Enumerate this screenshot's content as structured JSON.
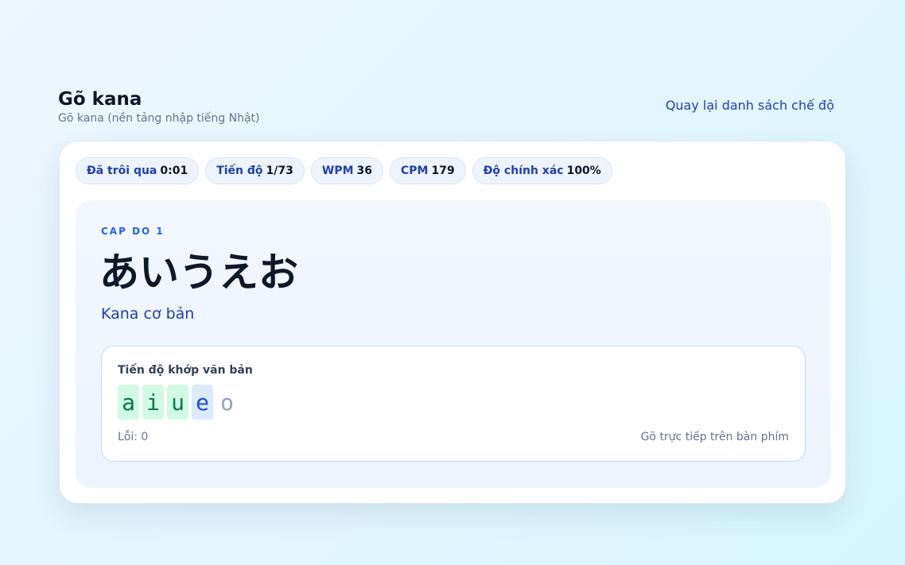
{
  "header": {
    "title": "Gõ kana",
    "subtitle": "Gõ kana (nền tảng nhập tiếng Nhật)",
    "back_link": "Quay lại danh sách chế độ"
  },
  "stats": [
    {
      "label": "Đã trôi qua",
      "value": "0:01"
    },
    {
      "label": "Tiến độ",
      "value": "1/73"
    },
    {
      "label": "WPM",
      "value": "36"
    },
    {
      "label": "CPM",
      "value": "179"
    },
    {
      "label": "Độ chính xác",
      "value": "100%"
    }
  ],
  "lesson": {
    "level_label": "CAP DO 1",
    "kana": "あいうえお",
    "description": "Kana cơ bản"
  },
  "match": {
    "title": "Tiến độ khớp văn bản",
    "chars": [
      {
        "char": "a",
        "state": "done"
      },
      {
        "char": "i",
        "state": "done"
      },
      {
        "char": "u",
        "state": "done"
      },
      {
        "char": "e",
        "state": "current"
      },
      {
        "char": "o",
        "state": "pending"
      }
    ],
    "errors": "Lỗi: 0",
    "hint": "Gõ trực tiếp trên bàn phím"
  },
  "colors": {
    "accent": "#1e40af",
    "done_bg": "#d1fae5",
    "current_bg": "#dbeafe",
    "pending_text": "#94a3b8"
  }
}
